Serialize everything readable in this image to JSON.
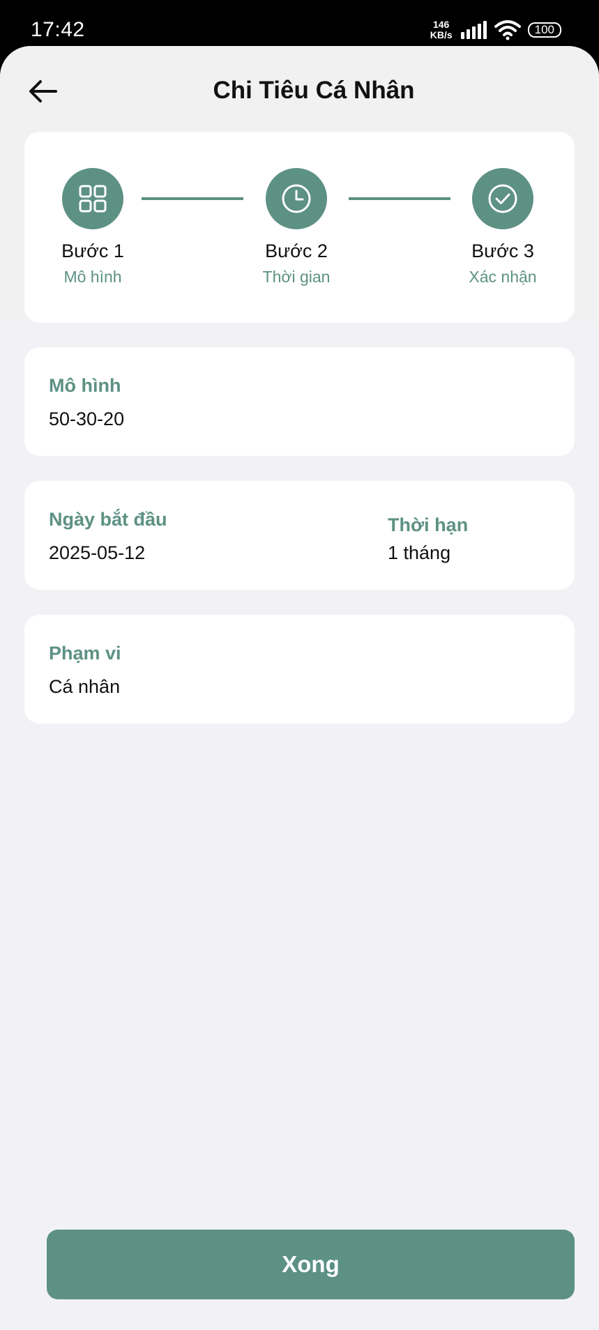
{
  "status": {
    "time": "17:42",
    "net_speed_value": "146",
    "net_speed_unit": "KB/s",
    "battery": "100"
  },
  "header": {
    "title": "Chi Tiêu Cá Nhân"
  },
  "steps": [
    {
      "title": "Bước 1",
      "subtitle": "Mô hình",
      "icon": "grid-icon"
    },
    {
      "title": "Bước 2",
      "subtitle": "Thời gian",
      "icon": "clock-icon"
    },
    {
      "title": "Bước 3",
      "subtitle": "Xác nhận",
      "icon": "check-circle-icon"
    }
  ],
  "model": {
    "label": "Mô hình",
    "value": "50-30-20"
  },
  "period": {
    "start_label": "Ngày bắt đầu",
    "start_value": "2025-05-12",
    "duration_label": "Thời hạn",
    "duration_value": "1 tháng"
  },
  "scope": {
    "label": "Phạm vi",
    "value": "Cá nhân"
  },
  "actions": {
    "done_label": "Xong"
  },
  "colors": {
    "accent": "#5d9183",
    "background": "#f2f2f6",
    "card": "#ffffff"
  }
}
